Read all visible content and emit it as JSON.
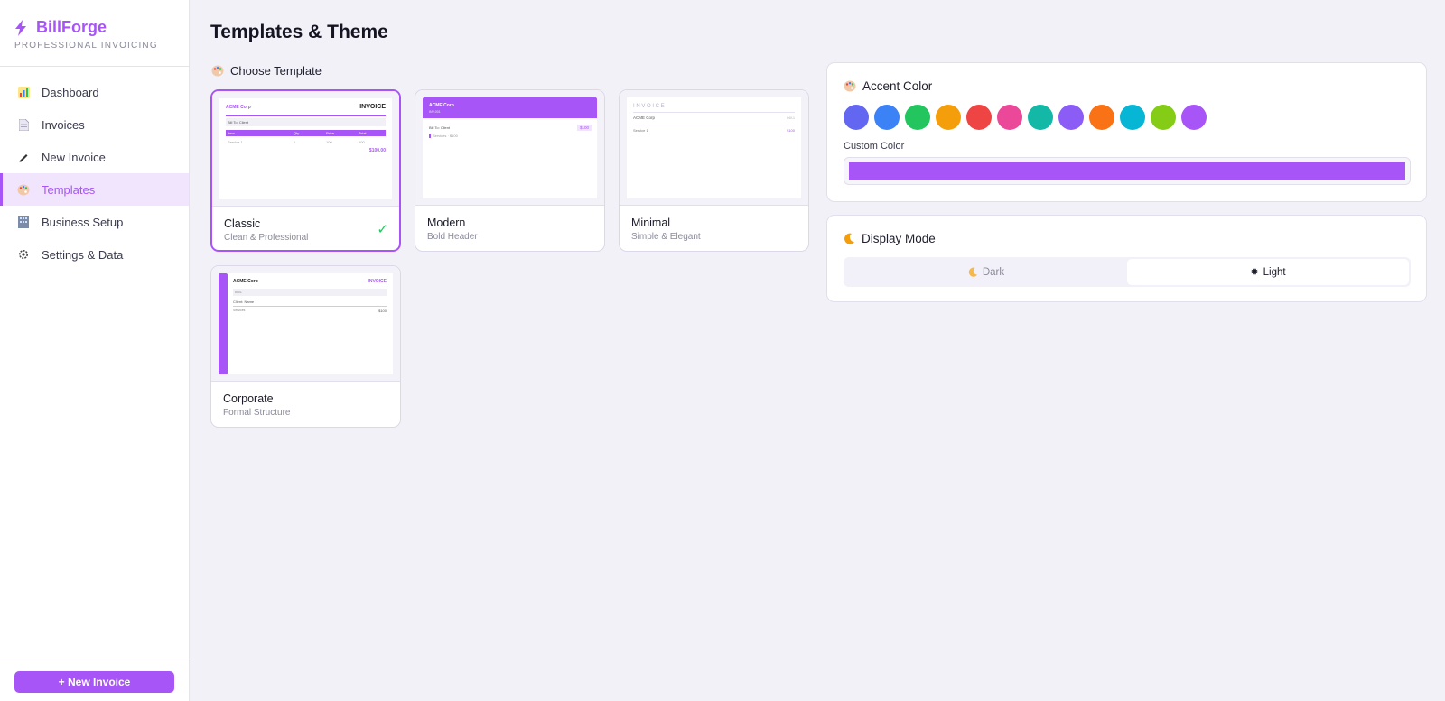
{
  "brand": {
    "name": "BillForge",
    "tagline": "PROFESSIONAL INVOICING"
  },
  "nav": [
    {
      "label": "Dashboard",
      "icon": "bar-chart-icon"
    },
    {
      "label": "Invoices",
      "icon": "document-icon"
    },
    {
      "label": "New Invoice",
      "icon": "pen-icon"
    },
    {
      "label": "Templates",
      "icon": "palette-icon",
      "active": true
    },
    {
      "label": "Business Setup",
      "icon": "building-icon"
    },
    {
      "label": "Settings & Data",
      "icon": "gear-icon"
    }
  ],
  "sidebar_button": "+ New Invoice",
  "page": {
    "title": "Templates & Theme"
  },
  "templates_section": {
    "title": "Choose Template"
  },
  "templates": [
    {
      "name": "Classic",
      "desc": "Clean & Professional",
      "selected": true
    },
    {
      "name": "Modern",
      "desc": "Bold Header"
    },
    {
      "name": "Minimal",
      "desc": "Simple & Elegant"
    },
    {
      "name": "Corporate",
      "desc": "Formal Structure"
    }
  ],
  "previews": {
    "company": "ACME Corp",
    "invoice_word": "INVOICE",
    "invoice_spaced": "I N V O I C E",
    "bill_to": "Bill To: Client",
    "cols": [
      "Item",
      "Qty",
      "Price",
      "Total"
    ],
    "row": [
      "Service 1",
      "1",
      "100",
      "100"
    ],
    "total": "$100.00",
    "modern_sub": "INV-001",
    "modern_amount": "$100",
    "modern_line": "Services · $100",
    "minimal_service": "Service 1",
    "minimal_amount": "$100",
    "minimal_right": "INV-1",
    "corp_ref": "#001",
    "corp_client": "Client: Name",
    "corp_service": "Services",
    "corp_amount": "$100"
  },
  "accent": {
    "title": "Accent Color",
    "custom_label": "Custom Color",
    "current": "#a855f7",
    "swatches": [
      "#6366f1",
      "#3b82f6",
      "#22c55e",
      "#f59e0b",
      "#ef4444",
      "#ec4899",
      "#14b8a6",
      "#8b5cf6",
      "#f97316",
      "#06b6d4",
      "#84cc16",
      "#a855f7"
    ]
  },
  "display": {
    "title": "Display Mode",
    "options": [
      {
        "label": "Dark",
        "icon": "moon-icon"
      },
      {
        "label": "Light",
        "icon": "sun-icon",
        "selected": true
      }
    ]
  }
}
